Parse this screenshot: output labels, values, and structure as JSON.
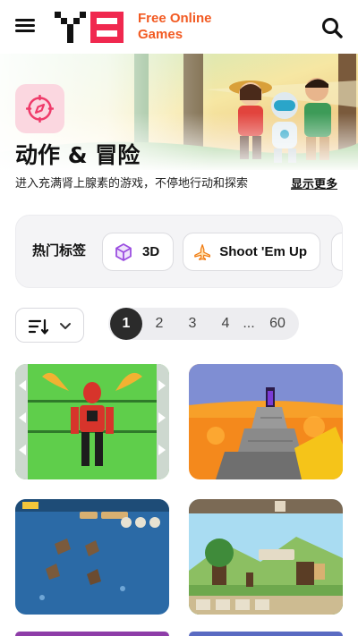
{
  "header": {
    "logo_text_line1": "Free Online",
    "logo_text_line2": "Games",
    "brand_color": "#f25a22"
  },
  "hero": {
    "title": "动作 & 冒险",
    "description": "进入充满肾上腺素的游戏，不停地行动和探索",
    "show_more": "显示更多",
    "icon": "compass-icon"
  },
  "tags": {
    "label": "热门标签",
    "items": [
      {
        "label": "3D",
        "icon": "cube-icon"
      },
      {
        "label": "Shoot 'Em Up",
        "icon": "jet-icon"
      }
    ]
  },
  "sort": {
    "icon": "sort-icon",
    "chevron": "chevron-down-icon"
  },
  "pagination": {
    "current": "1",
    "pages": [
      "1",
      "2",
      "3",
      "4"
    ],
    "ellipsis": "...",
    "last": "60"
  },
  "games": [
    {
      "thumb": "alien-transform-game"
    },
    {
      "thumb": "lava-parkour-game"
    },
    {
      "thumb": "naval-battle-game"
    },
    {
      "thumb": "pixel-adventure-game"
    }
  ]
}
